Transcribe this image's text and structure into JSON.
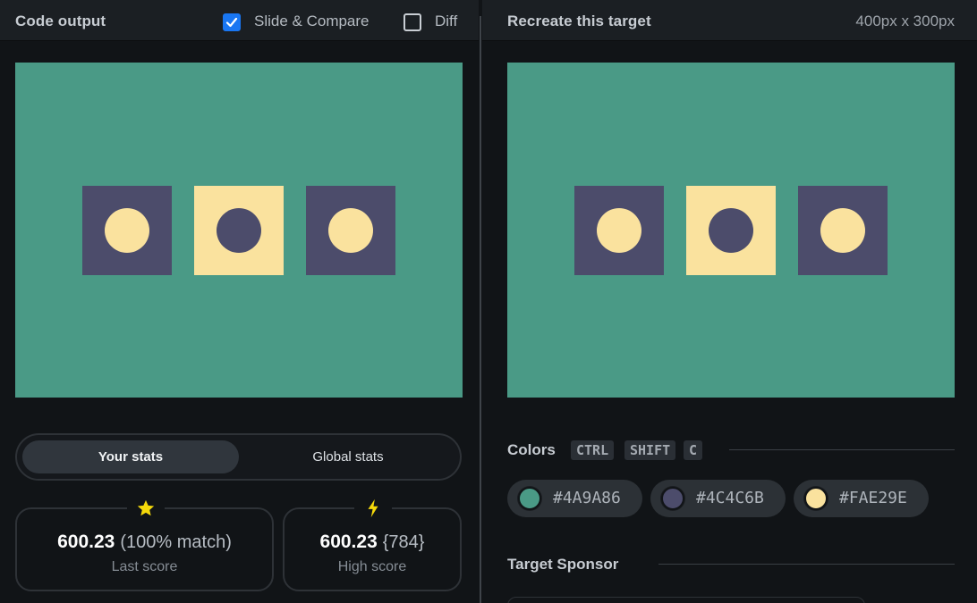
{
  "colors": {
    "canvas_bg": "#4a9a86",
    "dark": "#4c4c6b",
    "light": "#fae29e",
    "accent": "#1976f2"
  },
  "output": {
    "title": "Code output",
    "slide_compare": {
      "label": "Slide & Compare",
      "checked": true
    },
    "diff": {
      "label": "Diff",
      "checked": false
    }
  },
  "target": {
    "title": "Recreate this target",
    "size": "400px x 300px"
  },
  "stats": {
    "tabs": [
      {
        "label": "Your stats",
        "active": true
      },
      {
        "label": "Global stats",
        "active": false
      }
    ],
    "last": {
      "icon": "star-icon",
      "value": "600.23",
      "extra": "(100% match)",
      "caption": "Last score"
    },
    "high": {
      "icon": "lightning-icon",
      "value": "600.23",
      "extra": "{784}",
      "caption": "High score"
    }
  },
  "colors_section": {
    "title": "Colors",
    "shortcut": [
      "CTRL",
      "SHIFT",
      "C"
    ],
    "swatches": [
      {
        "hex": "#4A9A86",
        "color": "#4a9a86"
      },
      {
        "hex": "#4C4C6B",
        "color": "#4c4c6b"
      },
      {
        "hex": "#FAE29E",
        "color": "#fae29e"
      }
    ]
  },
  "sponsor": {
    "title": "Target Sponsor"
  }
}
